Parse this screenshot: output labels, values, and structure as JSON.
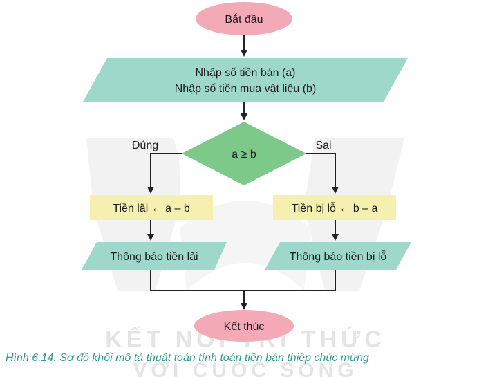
{
  "flowchart": {
    "start_label": "Bắt đầu",
    "input_line1": "Nhập số tiền bán (a)",
    "input_line2": "Nhập số tiền mua vật liệu (b)",
    "condition": "a ≥ b",
    "yes_branch_label": "Đúng",
    "no_branch_label": "Sai",
    "process_profit": "Tiền lãi ← a – b",
    "process_loss": "Tiền bị lỗ ← b – a",
    "output_profit": "Thông báo tiền lãi",
    "output_loss": "Thông báo tiền bị lỗ",
    "end_label": "Kết thúc"
  },
  "watermark": {
    "line1": "KẾT NỐI TRI THỨC",
    "line2": "VỚI CUỘC SỐNG"
  },
  "caption": "Hình 6.14. Sơ đồ khối mô tả thuật toán tính toán tiền bán thiệp chúc mừng",
  "colors": {
    "terminal": "#f4a9b6",
    "io": "#9ed8cb",
    "decision": "#7dc98a",
    "process": "#f5efb0",
    "arrow": "#222222",
    "caption": "#2e9a8a"
  }
}
